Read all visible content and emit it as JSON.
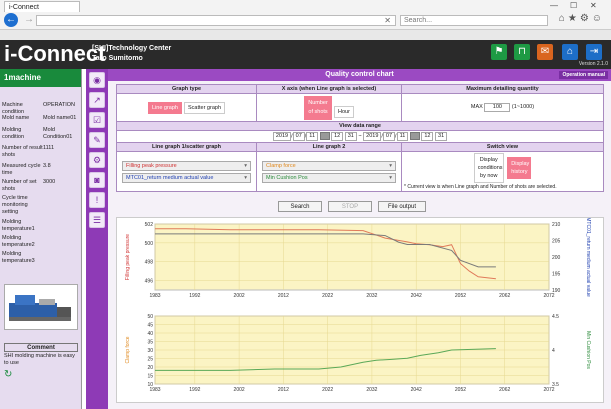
{
  "browser": {
    "tab_title": "i-Connect",
    "search_placeholder": "Search...",
    "window_controls": [
      "—",
      "☐",
      "✕"
    ],
    "toolbar_icons": [
      "⌂",
      "★",
      "⚙",
      "☺"
    ]
  },
  "header": {
    "app_name": "i-Connect",
    "company": "[SHI]Technology Center",
    "user": "Taro Sumitomo",
    "version": "Version 2.1.0"
  },
  "sidebar": {
    "machine_title": "1machine",
    "rows": [
      {
        "label": "Machine condition",
        "value": "OPERATION"
      },
      {
        "label": "Mold name",
        "value": "Mold name01"
      },
      {
        "label": "Molding condition",
        "value": "Mold Condition01"
      },
      {
        "label": "Number of result shots",
        "value": "1111"
      },
      {
        "label": "Measured cycle time",
        "value": "3.8"
      },
      {
        "label": "Number of set shots",
        "value": "3000"
      },
      {
        "label": "Cycle time monitoring setting",
        "value": ""
      },
      {
        "label": "Molding temperature1",
        "value": ""
      },
      {
        "label": "Molding temperature2",
        "value": ""
      },
      {
        "label": "Molding temperature3",
        "value": ""
      }
    ],
    "comment_header": "Comment",
    "comment_text": "SHI molding machine is easy to use"
  },
  "main": {
    "title": "Quality control chart",
    "manual_label": "Operation manual",
    "graph_type": {
      "header": "Graph type",
      "line": "Line graph",
      "scatter": "Scatter graph"
    },
    "x_axis": {
      "header": "X axis (when Line graph is selected)",
      "shots": "Number of shots",
      "hour": "Hour"
    },
    "max_detail": {
      "header": "Maximum detailing quantity",
      "prefix": "MAX",
      "value": "100",
      "range": "(1~1000)"
    },
    "range": {
      "header": "View data range",
      "start": {
        "year": "2019",
        "month": "07",
        "day": "11",
        "hour": "12",
        "minute": "31"
      },
      "end": {
        "year": "2019",
        "month": "07",
        "day": "11",
        "hour": "12",
        "minute": "31"
      }
    },
    "graph1": {
      "header": "Line graph 1/scatter graph",
      "sel1": "Filling peak pressure",
      "sel2": "MTC01_return medium actual value"
    },
    "graph2": {
      "header": "Line graph 2",
      "sel1": "Clamp force",
      "sel2": "Min Cushion Pos"
    },
    "switch_view": {
      "header": "Switch view",
      "display_now": "Display conditions by now",
      "display_history": "Display history",
      "note": "* Current view is when Line graph and Number of shots are selected."
    },
    "buttons": {
      "search": "Search",
      "stop": "STOP",
      "output": "File output"
    }
  },
  "chart_data": [
    {
      "type": "line",
      "x_ticks": [
        "1983",
        "1992",
        "2002",
        "2012",
        "2022",
        "2032",
        "2042",
        "2052",
        "2062",
        "2072"
      ],
      "ylabel_left": "Filling peak pressure",
      "ylabel_right": "MTC01_return medium actual value",
      "ylim_left": [
        495,
        502
      ],
      "yticks_left": [
        "502",
        "500",
        "498",
        "496"
      ],
      "ylim_right": [
        190,
        210
      ],
      "yticks_right": [
        "210",
        "205",
        "200",
        "195",
        "190"
      ],
      "series": [
        {
          "name": "Filling peak pressure",
          "color": "#e07a5a",
          "x": [
            1983,
            1990,
            2000,
            2010,
            2020,
            2030,
            2035,
            2040,
            2042,
            2045,
            2048,
            2050,
            2052,
            2054,
            2056,
            2060
          ],
          "y": [
            501.5,
            501.5,
            501.4,
            501.4,
            501.4,
            501.3,
            500.5,
            500.1,
            499.9,
            499.8,
            499.6,
            499.8,
            497.8,
            497,
            496.4,
            496.2
          ]
        },
        {
          "name": "MTC01_return medium actual value",
          "color": "#7a7a7a",
          "x": [
            1983,
            1990,
            2000,
            2010,
            2020,
            2030,
            2035,
            2038,
            2040,
            2045,
            2050,
            2052,
            2056,
            2060
          ],
          "y": [
            207,
            207,
            207,
            207,
            207,
            207,
            206.5,
            204.5,
            203.8,
            203.8,
            202,
            199,
            197,
            197
          ]
        }
      ]
    },
    {
      "type": "line",
      "x_ticks": [
        "1983",
        "1992",
        "2002",
        "2012",
        "2022",
        "2032",
        "2042",
        "2052",
        "2062",
        "2072"
      ],
      "ylabel_left": "Clamp force",
      "ylabel_right": "Min Cushion Pos",
      "ylim_left": [
        10,
        50
      ],
      "yticks_left": [
        "50",
        "45",
        "40",
        "35",
        "30",
        "25",
        "20",
        "15",
        "10"
      ],
      "ylim_right": [
        3.5,
        4.5
      ],
      "yticks_right": [
        "4.5",
        "4",
        "3.5"
      ],
      "series": [
        {
          "name": "Min Cushion Pos",
          "color": "#5aa857",
          "x": [
            1983,
            1990,
            2000,
            2010,
            2020,
            2025,
            2030,
            2033,
            2036,
            2040,
            2043,
            2047,
            2050,
            2060
          ],
          "y": [
            3.7,
            3.7,
            3.7,
            3.72,
            3.72,
            3.75,
            3.82,
            3.85,
            3.86,
            3.88,
            3.92,
            3.96,
            4.0,
            4.02
          ]
        }
      ]
    }
  ]
}
